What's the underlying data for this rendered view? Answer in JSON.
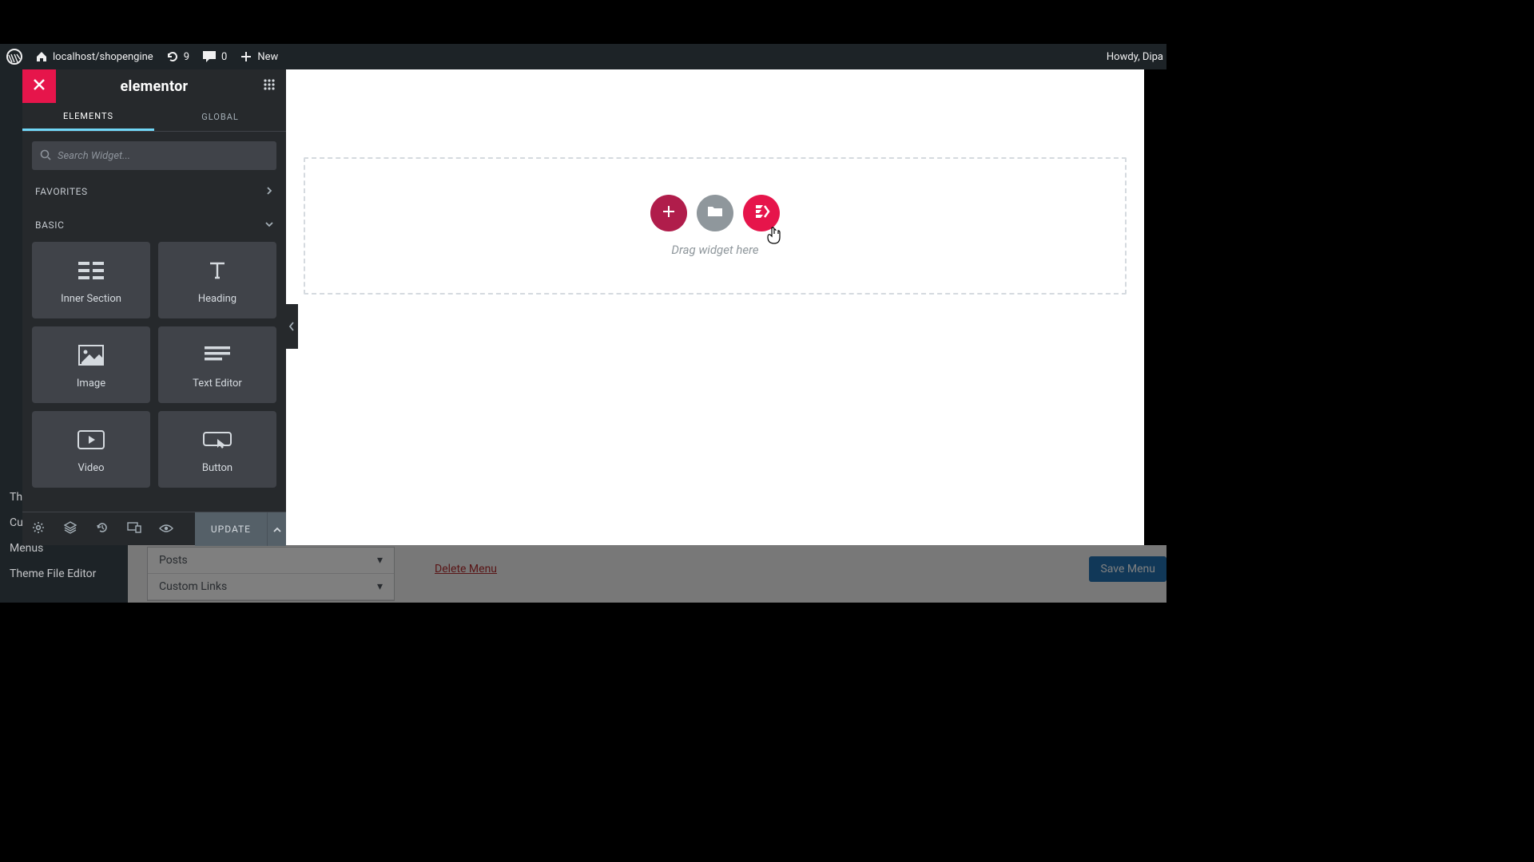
{
  "wp_bar": {
    "site": "localhost/shopengine",
    "updates": "9",
    "comments": "0",
    "new": "New",
    "greeting": "Howdy, Dipa"
  },
  "wp_side": {
    "items": [
      "Themes",
      "Customize",
      "Menus",
      "Theme File Editor"
    ]
  },
  "wp_below": {
    "posts": "Posts",
    "custom": "Custom Links",
    "delete": "Delete Menu",
    "save": "Save Menu"
  },
  "editor": {
    "brand": "elementor",
    "tabs": {
      "elements": "ELEMENTS",
      "global": "GLOBAL"
    },
    "search_placeholder": "Search Widget...",
    "categories": {
      "favorites": "FAVORITES",
      "basic": "BASIC"
    },
    "widgets": {
      "inner_section": "Inner Section",
      "heading": "Heading",
      "image": "Image",
      "text_editor": "Text Editor",
      "video": "Video",
      "button": "Button"
    },
    "update": "UPDATE"
  },
  "canvas": {
    "drop_label": "Drag widget here"
  },
  "colors": {
    "accent": "#e6154b",
    "wp_blue": "#2271b1"
  }
}
